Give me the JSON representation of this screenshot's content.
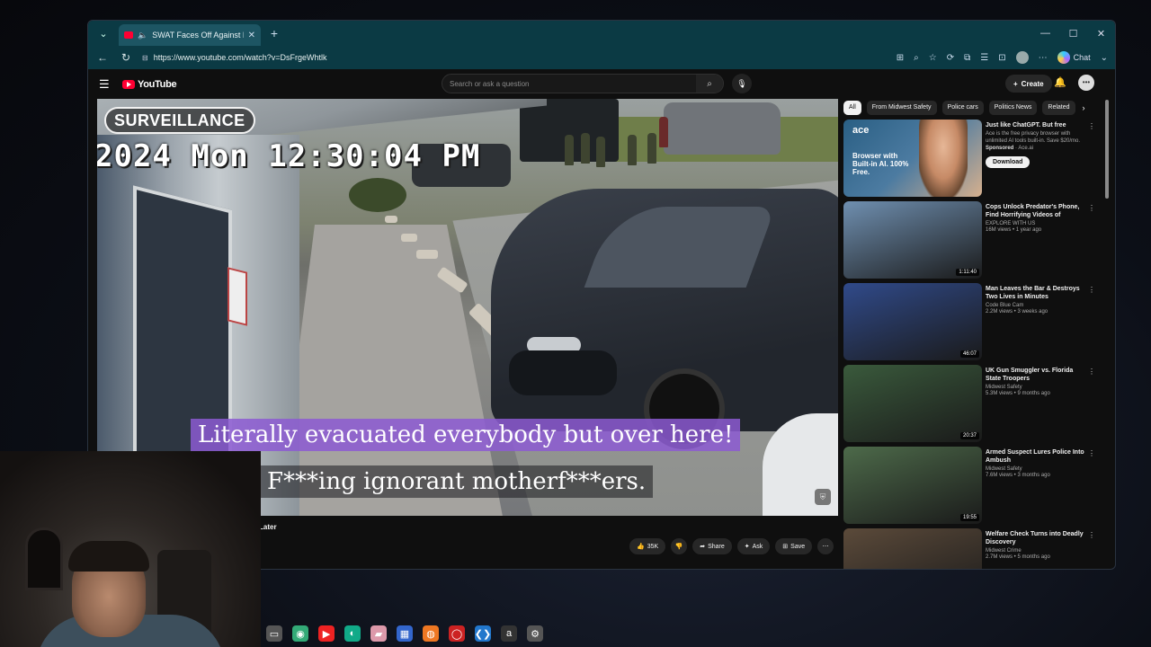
{
  "browser": {
    "tab_title": "SWAT Faces Off Against Killer",
    "url": "https://www.youtube.com/watch?v=DsFrgeWhtlk",
    "chat_label": "Chat"
  },
  "youtube": {
    "logo_text": "YouTube",
    "search_placeholder": "Search or ask a question",
    "create_label": "Create"
  },
  "video": {
    "overlay_label": "SURVEILLANCE",
    "timestamp": "2024 Mon 12:30:04 PM",
    "subtitle_line1": "Literally evacuated everybody but over here!",
    "subtitle_line2": "F***ing ignorant motherf***ers.",
    "title_fragment": "Later",
    "likes": "35K",
    "share_label": "Share",
    "ask_label": "Ask",
    "save_label": "Save"
  },
  "chips": [
    "All",
    "From Midwest Safety",
    "Police cars",
    "Politics News",
    "Related"
  ],
  "ad": {
    "title": "Just like ChatGPT. But free",
    "description": "Ace is the free privacy browser with unlimited AI tools built-in. Save $20/mo.",
    "sponsored": "Sponsored",
    "advertiser": "Ace.ai",
    "brand": "ace",
    "headline": "Browser with Built-in AI. 100% Free.",
    "button": "Download"
  },
  "recommendations": [
    {
      "title": "Cops Unlock Predator's Phone, Find Horrifying Videos of Missing...",
      "channel": "EXPLORE WITH US",
      "meta": "16M views • 1 year ago",
      "duration": "1:11:40",
      "color": "#6f8fb0"
    },
    {
      "title": "Man Leaves the Bar & Destroys Two Lives in Minutes",
      "channel": "Code Blue Cam",
      "meta": "2.2M views • 3 weeks ago",
      "duration": "46:07",
      "color": "#304a8a"
    },
    {
      "title": "UK Gun Smuggler vs. Florida State Troopers",
      "channel": "Midwest Safety",
      "meta": "5.3M views • 9 months ago",
      "duration": "20:37",
      "color": "#3a5a3c"
    },
    {
      "title": "Armed Suspect Lures Police Into Ambush",
      "channel": "Midwest Safety",
      "meta": "7.6M views • 3 months ago",
      "duration": "19:55",
      "color": "#4d6a4a"
    },
    {
      "title": "Welfare Check Turns into Deadly Discovery",
      "channel": "Midwest Crime",
      "meta": "2.7M views • 5 months ago",
      "duration": "",
      "color": "#5b4a3a"
    }
  ],
  "taskbar_icons": [
    "file-explorer-icon",
    "chrome-icon",
    "youtube-icon",
    "edge-icon",
    "folder-icon",
    "store-icon",
    "firefox-icon",
    "opera-icon",
    "vscode-icon",
    "amazon-icon",
    "settings-icon"
  ]
}
